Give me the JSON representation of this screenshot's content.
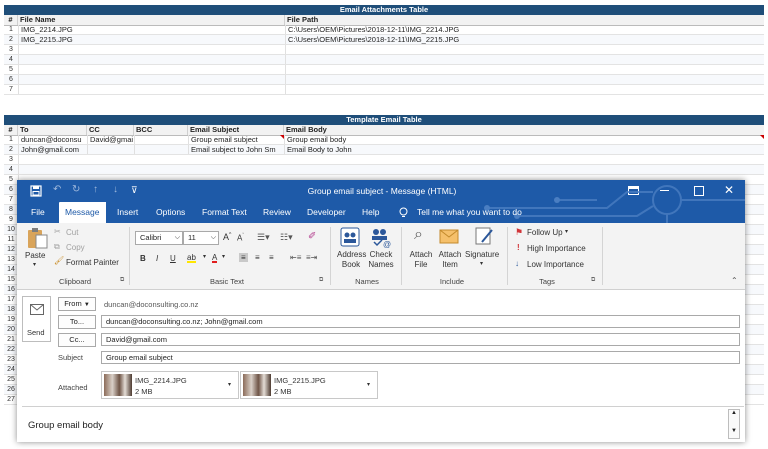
{
  "attachments_table": {
    "title": "Email Attachments  Table",
    "headers": [
      "#",
      "File Name",
      "File Path"
    ],
    "rows": [
      {
        "n": "1",
        "name": "IMG_2214.JPG",
        "path": "C:\\Users\\OEM\\Pictures\\2018-12-11\\IMG_2214.JPG"
      },
      {
        "n": "2",
        "name": "IMG_2215.JPG",
        "path": "C:\\Users\\OEM\\Pictures\\2018-12-11\\IMG_2215.JPG"
      },
      {
        "n": "3",
        "name": "",
        "path": ""
      },
      {
        "n": "4",
        "name": "",
        "path": ""
      },
      {
        "n": "5",
        "name": "",
        "path": ""
      },
      {
        "n": "6",
        "name": "",
        "path": ""
      },
      {
        "n": "7",
        "name": "",
        "path": ""
      }
    ]
  },
  "template_table": {
    "title": "Template Email Table",
    "headers": [
      "#",
      "To",
      "CC",
      "BCC",
      "Email Subject",
      "Email Body"
    ],
    "rows": [
      {
        "n": "1",
        "to": "duncan@doconsu",
        "cc": "David@gmail.com",
        "bcc": "",
        "subject": "Group email subject",
        "body": "Group email body"
      },
      {
        "n": "2",
        "to": "John@gmail.com",
        "cc": "",
        "bcc": "",
        "subject": "Email subject to John Sm",
        "body": "Email Body to John"
      }
    ],
    "extra_row_numbers": [
      "3",
      "4",
      "5",
      "6",
      "7",
      "8",
      "9",
      "10",
      "11",
      "12",
      "13",
      "14",
      "15",
      "16",
      "17",
      "18",
      "19",
      "20",
      "21",
      "22",
      "23",
      "24",
      "25",
      "26",
      "27"
    ]
  },
  "window": {
    "title": "Group email subject  -  Message (HTML)",
    "tabs": [
      "File",
      "Message",
      "Insert",
      "Options",
      "Format Text",
      "Review",
      "Developer",
      "Help"
    ],
    "tell_me": "Tell me what you want to do"
  },
  "ribbon": {
    "paste": "Paste",
    "cut": "Cut",
    "copy": "Copy",
    "format_painter": "Format Painter",
    "clipboard": "Clipboard",
    "font": "Calibri",
    "size": "11",
    "basic_text": "Basic Text",
    "address_book": [
      "Address",
      "Book"
    ],
    "check_names": [
      "Check",
      "Names"
    ],
    "names": "Names",
    "attach_file": [
      "Attach",
      "File"
    ],
    "attach_item": [
      "Attach",
      "Item"
    ],
    "signature": "Signature",
    "include": "Include",
    "follow_up": "Follow Up",
    "high_importance": "High Importance",
    "low_importance": "Low Importance",
    "tags": "Tags"
  },
  "compose": {
    "send": "Send",
    "from_btn": "From",
    "from_value": "duncan@doconsulting.co.nz",
    "to_btn": "To...",
    "to_value": "duncan@doconsulting.co.nz; John@gmail.com",
    "cc_btn": "Cc...",
    "cc_value": "David@gmail.com",
    "subject_label": "Subject",
    "subject_value": "Group email subject",
    "attached_label": "Attached",
    "attachments": [
      {
        "name": "IMG_2214.JPG",
        "size": "2 MB"
      },
      {
        "name": "IMG_2215.JPG",
        "size": "2 MB"
      }
    ],
    "body": "Group email body"
  },
  "colors": {
    "title_bar": "#1e5aa8",
    "table_header": "#1f4e79"
  }
}
